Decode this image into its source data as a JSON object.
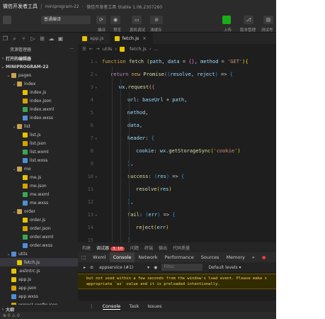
{
  "titlebar": {
    "app_name": "微信开发者工具",
    "project": "miniprogram-22",
    "subtitle": "微信开发者工具 Stable 1.06.2307260"
  },
  "toolbar": {
    "mode_select": "普通编译",
    "labels": {
      "compile": "编译",
      "preview": "预览",
      "real_debug": "真机调试",
      "clear_cache": "清缓存",
      "upload": "上传",
      "version": "版本管理",
      "test": "测试号"
    }
  },
  "sidebar": {
    "header": "资源管理器",
    "open_editors": "打开的编辑器",
    "project": "MINIPROGRAM-22",
    "tree": [
      {
        "label": "pages",
        "type": "folder",
        "depth": 1
      },
      {
        "label": "index",
        "type": "folder",
        "depth": 2
      },
      {
        "label": "index.js",
        "type": "js",
        "depth": 3
      },
      {
        "label": "index.json",
        "type": "json",
        "depth": 3
      },
      {
        "label": "index.wxml",
        "type": "wxml",
        "depth": 3
      },
      {
        "label": "index.wxss",
        "type": "wxss",
        "depth": 3
      },
      {
        "label": "list",
        "type": "folder",
        "depth": 2
      },
      {
        "label": "list.js",
        "type": "js",
        "depth": 3
      },
      {
        "label": "list.json",
        "type": "json",
        "depth": 3
      },
      {
        "label": "list.wxml",
        "type": "wxml",
        "depth": 3
      },
      {
        "label": "list.wxss",
        "type": "wxss",
        "depth": 3
      },
      {
        "label": "me",
        "type": "folder",
        "depth": 2
      },
      {
        "label": "me.js",
        "type": "js",
        "depth": 3
      },
      {
        "label": "me.json",
        "type": "json",
        "depth": 3
      },
      {
        "label": "me.wxml",
        "type": "wxml",
        "depth": 3
      },
      {
        "label": "me.wxss",
        "type": "wxss",
        "depth": 3
      },
      {
        "label": "order",
        "type": "folder",
        "depth": 2
      },
      {
        "label": "order.js",
        "type": "js",
        "depth": 3
      },
      {
        "label": "order.json",
        "type": "json",
        "depth": 3
      },
      {
        "label": "order.wxml",
        "type": "wxml",
        "depth": 3
      },
      {
        "label": "order.wxss",
        "type": "wxss",
        "depth": 3
      },
      {
        "label": "utils",
        "type": "folder-blue",
        "depth": 1
      },
      {
        "label": "fetch.js",
        "type": "js",
        "depth": 2,
        "selected": true
      },
      {
        "label": ".eslintrc.js",
        "type": "js",
        "depth": 1
      },
      {
        "label": "app.js",
        "type": "js",
        "depth": 1
      },
      {
        "label": "app.json",
        "type": "json",
        "depth": 1
      },
      {
        "label": "app.wxss",
        "type": "wxss",
        "depth": 1
      },
      {
        "label": "project.config.json",
        "type": "json",
        "depth": 1
      },
      {
        "label": "project.private.config.js",
        "type": "json",
        "depth": 1
      }
    ],
    "outline": "大纲"
  },
  "statusbar": {
    "text": "⊗ 0 ⚠ 0"
  },
  "editor": {
    "tabs": [
      {
        "label": "app.js",
        "active": false
      },
      {
        "label": "fetch.js",
        "active": true
      }
    ],
    "breadcrumb": [
      "utils",
      "fetch.js",
      "..."
    ],
    "lines": [
      {
        "n": "1",
        "fold": "⌄",
        "indent": 0,
        "parts": [
          [
            "k",
            "function "
          ],
          [
            "fn",
            "fetch "
          ],
          [
            "br1",
            "("
          ],
          [
            "id",
            "path"
          ],
          [
            "pl",
            ", "
          ],
          [
            "id",
            "data"
          ],
          [
            "pl",
            " = "
          ],
          [
            "br2",
            "{}"
          ],
          [
            "pl",
            ", "
          ],
          [
            "id",
            "method"
          ],
          [
            "pl",
            " = "
          ],
          [
            "str",
            "'GET'"
          ],
          [
            "br1",
            ")"
          ],
          [
            "br1",
            "{"
          ]
        ]
      },
      {
        "n": "2",
        "fold": "⌄",
        "indent": 1,
        "parts": [
          [
            "kw",
            "return "
          ],
          [
            "k",
            "new "
          ],
          [
            "fn",
            "Promise"
          ],
          [
            "br2",
            "("
          ],
          [
            "br3",
            "("
          ],
          [
            "id",
            "resolve"
          ],
          [
            "pl",
            ", "
          ],
          [
            "id",
            "reject"
          ],
          [
            "br3",
            ")"
          ],
          [
            "pl",
            " => "
          ],
          [
            "br3",
            "{"
          ]
        ]
      },
      {
        "n": "3",
        "fold": "⌄",
        "indent": 2,
        "parts": [
          [
            "id",
            "wx"
          ],
          [
            "pl",
            "."
          ],
          [
            "fn",
            "request"
          ],
          [
            "br1",
            "("
          ],
          [
            "br2",
            "{"
          ]
        ]
      },
      {
        "n": "4",
        "fold": "",
        "indent": 3,
        "parts": [
          [
            "id",
            "url"
          ],
          [
            "pl",
            ": "
          ],
          [
            "id",
            "baseUrl"
          ],
          [
            "pl",
            " + "
          ],
          [
            "id",
            "path"
          ],
          [
            "pl",
            ","
          ]
        ]
      },
      {
        "n": "5",
        "fold": "",
        "indent": 3,
        "parts": [
          [
            "id",
            "method"
          ],
          [
            "pl",
            ","
          ]
        ]
      },
      {
        "n": "6",
        "fold": "",
        "indent": 3,
        "parts": [
          [
            "id",
            "data"
          ],
          [
            "pl",
            ","
          ]
        ]
      },
      {
        "n": "7",
        "fold": "⌄",
        "indent": 3,
        "parts": [
          [
            "id",
            "header"
          ],
          [
            "pl",
            ": "
          ],
          [
            "br3",
            "{"
          ]
        ]
      },
      {
        "n": "8",
        "fold": "",
        "indent": 4,
        "parts": [
          [
            "id",
            "cookie"
          ],
          [
            "pl",
            ": "
          ],
          [
            "id",
            "wx"
          ],
          [
            "pl",
            "."
          ],
          [
            "fn",
            "getStorageSync"
          ],
          [
            "br1",
            "("
          ],
          [
            "str",
            "'cookie'"
          ],
          [
            "br1",
            ")"
          ]
        ]
      },
      {
        "n": "9",
        "fold": "",
        "indent": 3,
        "parts": [
          [
            "br3",
            "}"
          ],
          [
            "pl",
            ","
          ]
        ]
      },
      {
        "n": "10",
        "fold": "⌄",
        "indent": 3,
        "parts": [
          [
            "fn",
            "success"
          ],
          [
            "pl",
            ": "
          ],
          [
            "br3",
            "("
          ],
          [
            "id",
            "res"
          ],
          [
            "br3",
            ")"
          ],
          [
            "pl",
            " => "
          ],
          [
            "br3",
            "{"
          ]
        ]
      },
      {
        "n": "11",
        "fold": "",
        "indent": 4,
        "parts": [
          [
            "fn",
            "resolve"
          ],
          [
            "br1",
            "("
          ],
          [
            "id",
            "res"
          ],
          [
            "br1",
            ")"
          ]
        ]
      },
      {
        "n": "12",
        "fold": "",
        "indent": 3,
        "parts": [
          [
            "br3",
            "}"
          ],
          [
            "pl",
            ","
          ]
        ]
      },
      {
        "n": "13",
        "fold": "⌄",
        "indent": 3,
        "parts": [
          [
            "fn",
            "fail"
          ],
          [
            "pl",
            ": "
          ],
          [
            "br3",
            "("
          ],
          [
            "id",
            "err"
          ],
          [
            "br3",
            ")"
          ],
          [
            "pl",
            " => "
          ],
          [
            "br3",
            "{"
          ]
        ]
      },
      {
        "n": "14",
        "fold": "",
        "indent": 4,
        "parts": [
          [
            "fn",
            "reject"
          ],
          [
            "br1",
            "("
          ],
          [
            "id",
            "err"
          ],
          [
            "br1",
            ")"
          ]
        ]
      },
      {
        "n": "15",
        "fold": "",
        "indent": 3,
        "parts": [
          [
            "br3",
            "}"
          ]
        ]
      }
    ]
  },
  "panel": {
    "tabs": [
      {
        "label": "构建",
        "active": false
      },
      {
        "label": "调试器",
        "active": true,
        "badge": "3, 10"
      },
      {
        "label": "问题",
        "active": false
      },
      {
        "label": "终端",
        "active": false
      },
      {
        "label": "输出",
        "active": false
      },
      {
        "label": "代码质量",
        "active": false
      }
    ],
    "devtools_tabs": [
      {
        "label": "Wxml",
        "active": false
      },
      {
        "label": "Console",
        "active": true
      },
      {
        "label": "Network",
        "active": false
      },
      {
        "label": "Performance",
        "active": false
      },
      {
        "label": "Sources",
        "active": false
      },
      {
        "label": "Memory",
        "active": false
      }
    ],
    "devtools_more": "»",
    "context": "appservice (#1)",
    "filter_placeholder": "Filter",
    "levels": "Default levels",
    "warning_line1": "but not used within a few seconds from the window's load event. Please make s",
    "warning_line2": "appropriate `as` value and it is preloaded intentionally.",
    "bottom_tabs": [
      {
        "label": "Console",
        "active": true
      },
      {
        "label": "Task",
        "active": false
      },
      {
        "label": "Issues",
        "active": false
      }
    ]
  },
  "colors": {
    "editor_bg": "#1e1e1e",
    "sidebar_bg": "#252526",
    "accent_green": "#1aad19",
    "badge_red": "#e23f3f"
  }
}
